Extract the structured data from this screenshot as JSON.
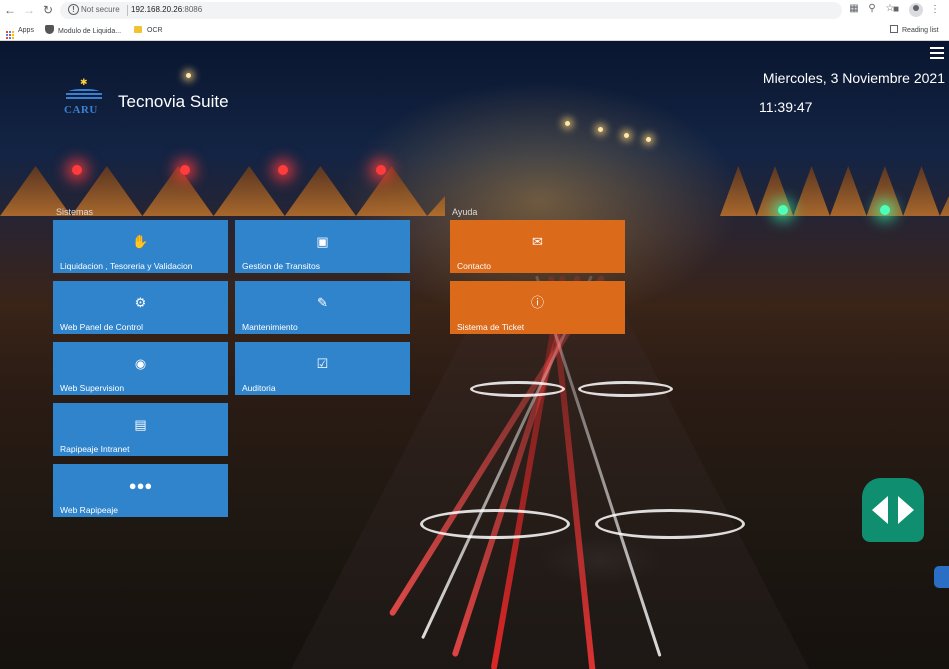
{
  "browser": {
    "security_label": "Not secure",
    "url_host": "192.168.20.26",
    "url_port": ":8086",
    "bookmarks": [
      {
        "label": "Apps",
        "icon": "apps-grid-icon"
      },
      {
        "label": "Modulo de Liquida...",
        "icon": "ship-icon"
      },
      {
        "label": "OCR",
        "icon": "folder-icon"
      }
    ],
    "reading_list": "Reading list"
  },
  "header": {
    "logo_text": "CARU",
    "app_title": "Tecnovia Suite",
    "date": "Miercoles, 3 Noviembre 2021",
    "time": "11:39:47"
  },
  "sections": {
    "sistemas": "Sistemas",
    "ayuda": "Ayuda"
  },
  "tiles": {
    "liquidacion": {
      "label": "Liquidacion , Tesoreria y Validacion",
      "icon": "hand-money-icon"
    },
    "gestion": {
      "label": "Gestion de Transitos",
      "icon": "car-icon"
    },
    "web_panel": {
      "label": "Web Panel de Control",
      "icon": "users-cog-icon"
    },
    "mantenimiento": {
      "label": "Mantenimiento",
      "icon": "file-edit-icon"
    },
    "web_supervision": {
      "label": "Web Supervision",
      "icon": "eye-icon"
    },
    "auditoria": {
      "label": "Auditoria",
      "icon": "calendar-check-icon"
    },
    "rapipeaje_intranet": {
      "label": "Rapipeaje Intranet",
      "icon": "id-card-icon"
    },
    "web_rapipeaje": {
      "label": "Web Rapipeaje",
      "icon": "users-icon"
    },
    "contacto": {
      "label": "Contacto",
      "icon": "envelope-icon"
    },
    "sistema_ticket": {
      "label": "Sistema de Ticket",
      "icon": "info-circle-icon"
    }
  },
  "colors": {
    "tile_blue": "#2f84cc",
    "tile_orange": "#db6a1b"
  }
}
